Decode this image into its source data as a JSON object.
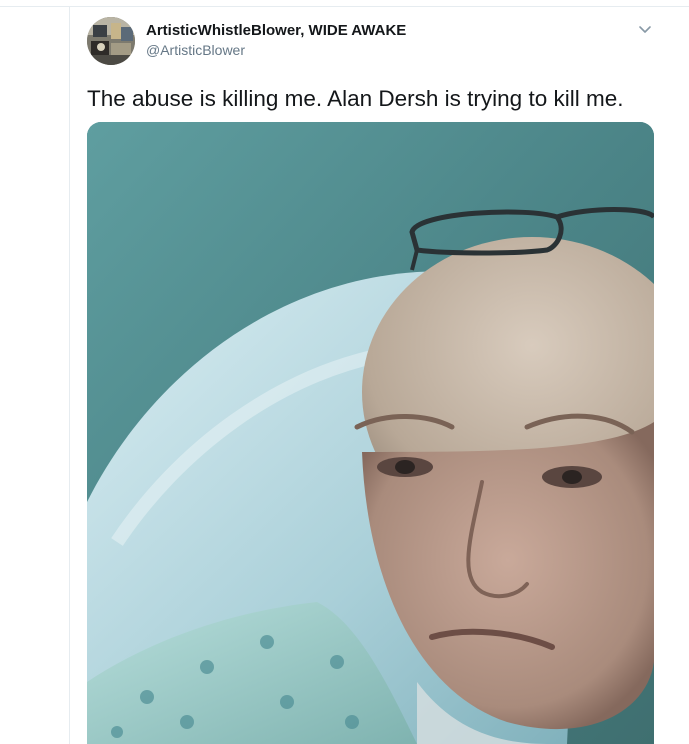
{
  "tweet": {
    "author": {
      "display_name": "ArtisticWhistleBlower, WIDE AWAKE",
      "handle": "@ArtisticBlower",
      "avatar_icon": "profile-photo"
    },
    "menu_icon": "chevron-down-icon",
    "text": "The abuse is killing me. Alan Dersh is trying to kill me.",
    "media": {
      "kind": "photo",
      "icon": "photo-icon"
    }
  },
  "colors": {
    "primary_text": "#14171a",
    "secondary_text": "#657786",
    "divider": "#e6ecf0",
    "chevron": "#8899a6"
  }
}
